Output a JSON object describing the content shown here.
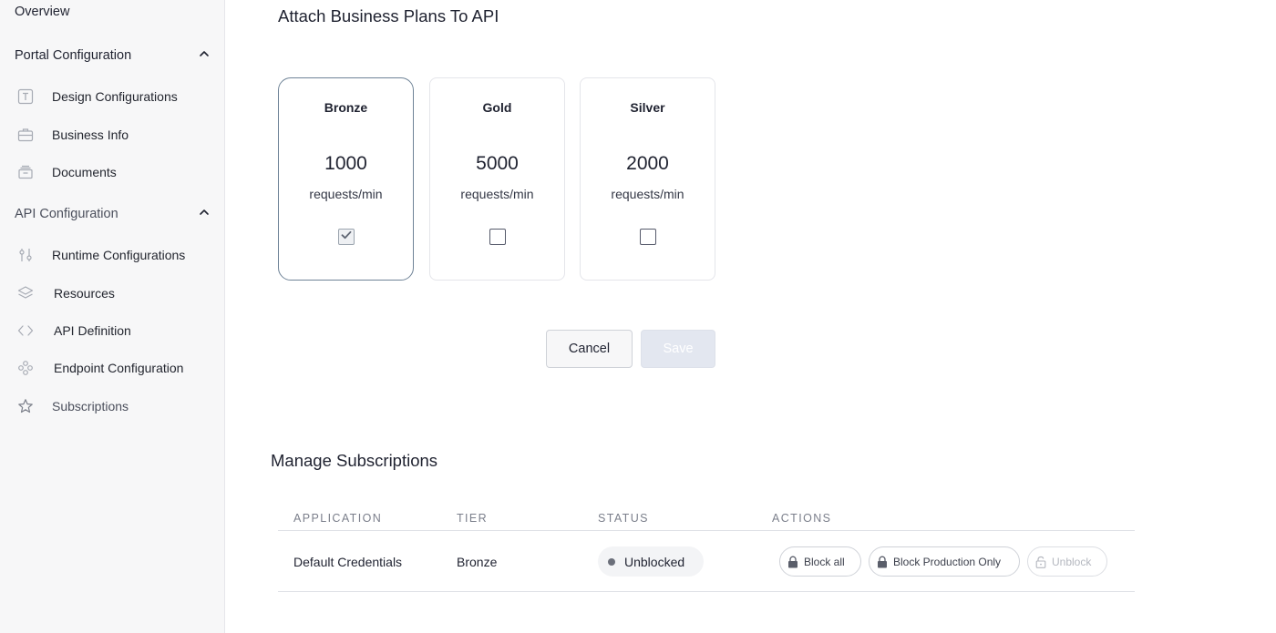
{
  "sidebar": {
    "overview": "Overview",
    "portal_section": "Portal Configuration",
    "portal_items": [
      {
        "label": "Design Configurations",
        "icon": "text-box-icon"
      },
      {
        "label": "Business Info",
        "icon": "briefcase-icon"
      },
      {
        "label": "Documents",
        "icon": "archive-icon"
      }
    ],
    "api_section": "API Configuration",
    "api_items": [
      {
        "label": "Runtime Configurations",
        "icon": "sliders-icon"
      },
      {
        "label": "Resources",
        "icon": "layers-icon"
      },
      {
        "label": "API Definition",
        "icon": "code-icon"
      },
      {
        "label": "Endpoint Configuration",
        "icon": "endpoint-icon"
      },
      {
        "label": "Subscriptions",
        "icon": "star-icon"
      }
    ]
  },
  "main": {
    "title": "Attach Business Plans To API",
    "plans": [
      {
        "name": "Bronze",
        "quota": "1000",
        "unit": "requests/min",
        "checked": true
      },
      {
        "name": "Gold",
        "quota": "5000",
        "unit": "requests/min",
        "checked": false
      },
      {
        "name": "Silver",
        "quota": "2000",
        "unit": "requests/min",
        "checked": false
      }
    ],
    "cancel_label": "Cancel",
    "save_label": "Save"
  },
  "subscriptions": {
    "title": "Manage Subscriptions",
    "columns": [
      "APPLICATION",
      "TIER",
      "STATUS",
      "ACTIONS"
    ],
    "rows": [
      {
        "application": "Default Credentials",
        "tier": "Bronze",
        "status": "Unblocked",
        "actions": [
          "Block all",
          "Block Production Only",
          "Unblock"
        ]
      }
    ]
  }
}
